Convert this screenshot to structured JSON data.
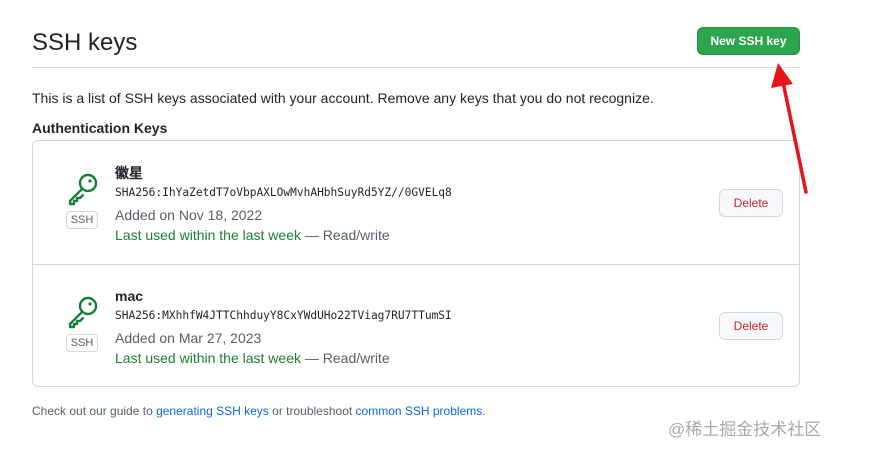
{
  "header": {
    "title": "SSH keys",
    "new_key_label": "New SSH key"
  },
  "intro": "This is a list of SSH keys associated with your account. Remove any keys that you do not recognize.",
  "section_heading": "Authentication Keys",
  "keys": [
    {
      "title": "徽星",
      "fingerprint": "SHA256:IhYaZetdT7oVbpAXLOwMvhAHbhSuyRd5YZ//0GVELq8",
      "added": "Added on Nov 18, 2022",
      "last_used": "Last used within the last week",
      "access": " — Read/write",
      "badge": "SSH",
      "delete_label": "Delete",
      "icon": "key-icon"
    },
    {
      "title": "mac",
      "fingerprint": "SHA256:MXhhfW4JTTChhduyY8CxYWdUHo22TViag7RU7TTumSI",
      "added": "Added on Mar 27, 2023",
      "last_used": "Last used within the last week",
      "access": " — Read/write",
      "badge": "SSH",
      "delete_label": "Delete",
      "icon": "key-icon"
    }
  ],
  "footer": {
    "prefix": "Check out our guide to ",
    "link1": "generating SSH keys",
    "middle": " or troubleshoot ",
    "link2": "common SSH problems",
    "suffix": "."
  },
  "watermark": "@稀土掘金技术社区",
  "colors": {
    "primary_button": "#2da44e",
    "recent_use": "#1a7f37",
    "danger": "#cf222e",
    "link": "#0969da",
    "annotation_arrow": "#e8141c"
  }
}
